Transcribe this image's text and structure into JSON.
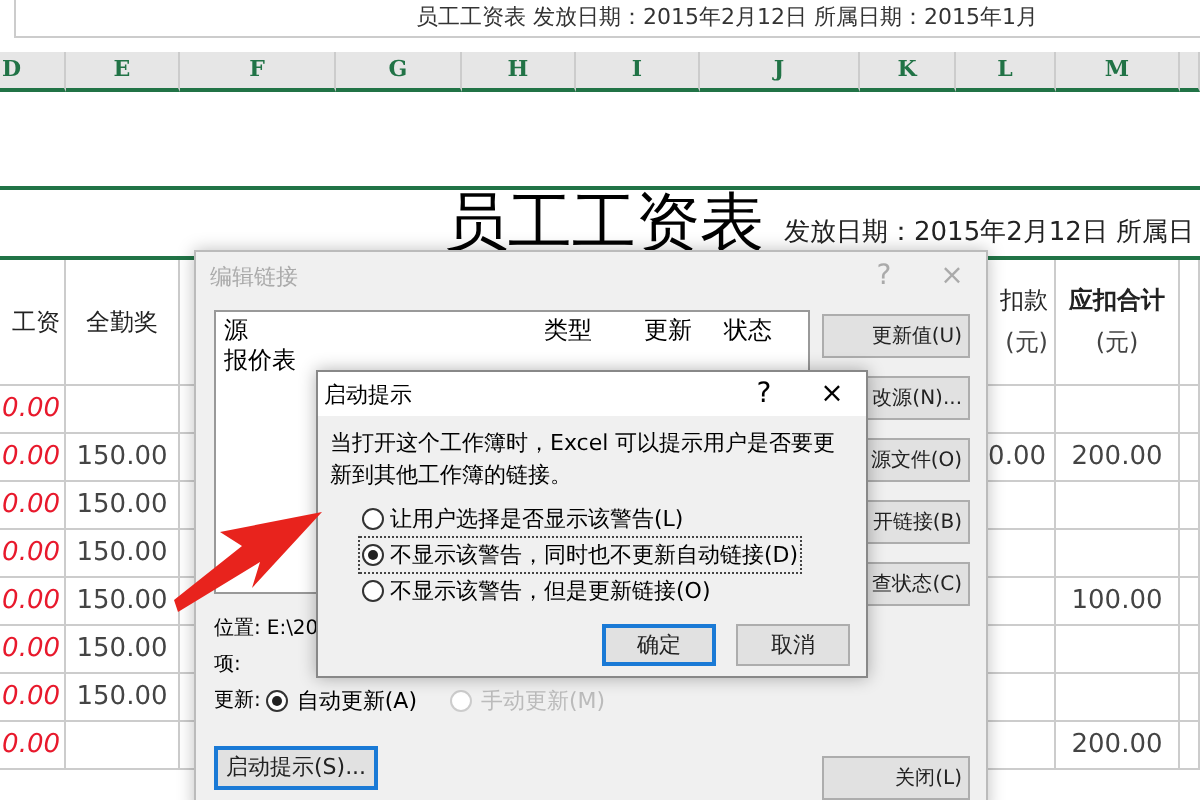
{
  "formula_bar": {
    "text": "员工工资表    发放日期：2015年2月12日  所属日期：2015年1月"
  },
  "columns": [
    {
      "label": "D",
      "heading": "工资",
      "kind": "red",
      "heading_bold": false
    },
    {
      "label": "E",
      "heading": "全勤奖",
      "kind": "plain",
      "heading_bold": false
    },
    {
      "label": "F",
      "kind": "plain"
    },
    {
      "label": "G",
      "kind": "plain"
    },
    {
      "label": "H",
      "kind": "plain"
    },
    {
      "label": "I",
      "kind": "plain"
    },
    {
      "label": "J",
      "kind": "plain"
    },
    {
      "label": "K",
      "kind": "plain"
    },
    {
      "label": "L",
      "heading": "扣款",
      "unit": "(元)",
      "kind": "plain",
      "heading_bold": false
    },
    {
      "label": "M",
      "heading": "应扣合计",
      "unit": "(元)",
      "kind": "plain",
      "heading_bold": true
    },
    {
      "kind": "plain"
    }
  ],
  "sheet": {
    "title": "员工工资表",
    "subtitle": "发放日期：2015年2月12日 所属日",
    "rows": [
      [
        "0.00",
        "",
        "",
        "",
        "",
        "",
        "",
        "",
        "",
        "",
        ""
      ],
      [
        "0.00",
        "150.00",
        "",
        "",
        "",
        "",
        "",
        "",
        "0.00",
        "200.00",
        ""
      ],
      [
        "0.00",
        "150.00",
        "",
        "",
        "",
        "",
        "",
        "",
        "",
        "",
        ""
      ],
      [
        "0.00",
        "150.00",
        "",
        "",
        "",
        "",
        "",
        "",
        "",
        "",
        ""
      ],
      [
        "0.00",
        "150.00",
        "",
        "",
        "",
        "",
        "",
        "",
        "",
        "100.00",
        ""
      ],
      [
        "0.00",
        "150.00",
        "",
        "",
        "",
        "",
        "",
        "",
        "",
        "",
        ""
      ],
      [
        "0.00",
        "150.00",
        "",
        "",
        "",
        "",
        "",
        "",
        "",
        "",
        ""
      ],
      [
        "0.00",
        "",
        "",
        "",
        "",
        "",
        "",
        "",
        "",
        "200.00",
        ""
      ]
    ]
  },
  "edit_links_dialog": {
    "title": "编辑链接",
    "help": "?",
    "close": "×",
    "list": {
      "columns": [
        "源",
        "类型",
        "更新",
        "状态"
      ],
      "rows": [
        [
          "报价表"
        ]
      ]
    },
    "buttons": [
      {
        "label": "更新值(U)",
        "focused": false
      },
      {
        "label": "改源(N)...",
        "focused": false
      },
      {
        "label": "源文件(O)",
        "focused": false
      },
      {
        "label": "开链接(B)",
        "focused": false
      },
      {
        "label": "查状态(C)",
        "focused": false
      }
    ],
    "location_label": "位置:",
    "location_value": "E:\\20",
    "item_label": "项:",
    "update_label": "更新:",
    "update_options": [
      {
        "label": "自动更新(A)",
        "selected": true,
        "disabled": false
      },
      {
        "label": "手动更新(M)",
        "selected": false,
        "disabled": true
      }
    ],
    "startup_button": {
      "label": "启动提示(S)...",
      "focused": true
    },
    "close_button": {
      "label": "关闭(L)",
      "focused": false
    }
  },
  "startup_dialog": {
    "title": "启动提示",
    "help": "?",
    "close": "×",
    "message": "当打开这个工作簿时，Excel 可以提示用户是否要更新到其他工作簿的链接。",
    "options": [
      {
        "label": "让用户选择是否显示该警告(L)",
        "selected": false
      },
      {
        "label": "不显示该警告，同时也不更新自动链接(D)",
        "selected": true
      },
      {
        "label": "不显示该警告，但是更新链接(O)",
        "selected": false
      }
    ],
    "buttons": [
      {
        "label": "确定",
        "focused": true
      },
      {
        "label": "取消",
        "focused": false
      }
    ]
  }
}
